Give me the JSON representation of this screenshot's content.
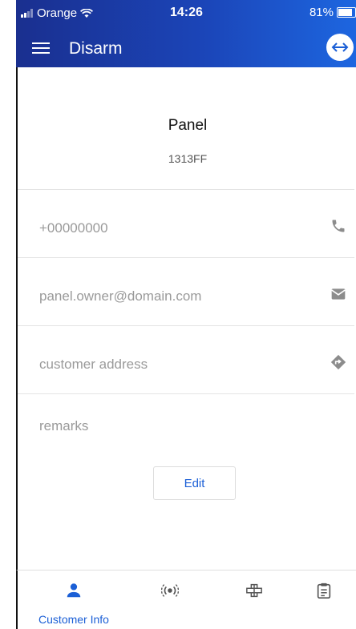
{
  "status_bar": {
    "carrier": "Orange",
    "time": "14:26",
    "battery": "81%"
  },
  "app_bar": {
    "title": "Disarm"
  },
  "panel": {
    "name": "Panel",
    "id": "1313FF"
  },
  "contact": {
    "phone": "+00000000",
    "email": "panel.owner@domain.com",
    "address": "customer address",
    "remarks": "remarks"
  },
  "actions": {
    "edit_label": "Edit"
  },
  "bottom_nav": {
    "tabs": [
      {
        "label": "Customer Info",
        "icon": "person-icon",
        "active": true
      },
      {
        "label": "",
        "icon": "sensor-icon",
        "active": false
      },
      {
        "label": "",
        "icon": "zones-icon",
        "active": false
      },
      {
        "label": "",
        "icon": "clipboard-icon",
        "active": false
      }
    ]
  },
  "colors": {
    "accent": "#1b5fd6",
    "header_start": "#1a2f8f",
    "header_end": "#1d66e0"
  }
}
